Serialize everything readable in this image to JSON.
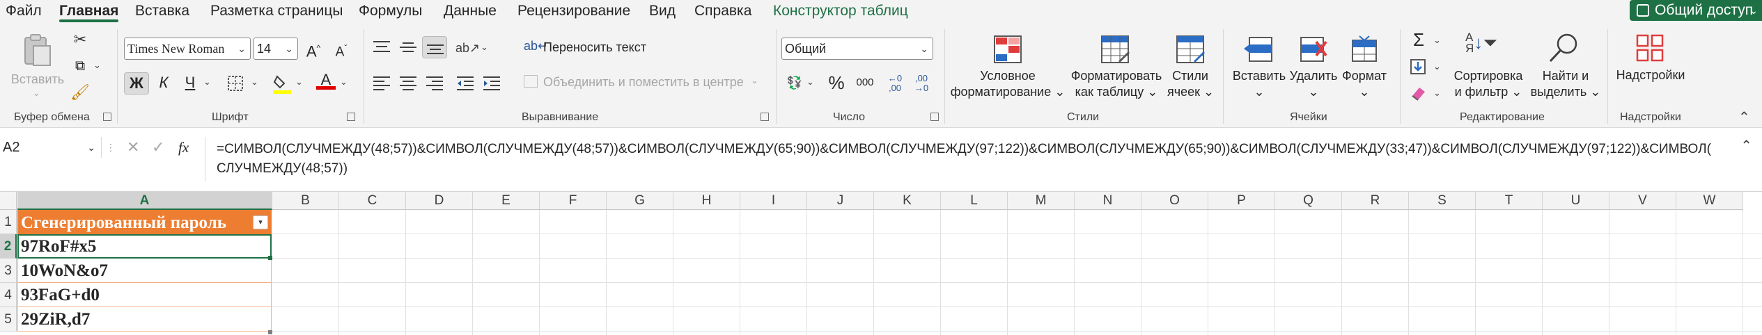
{
  "tabs": [
    "Файл",
    "Главная",
    "Вставка",
    "Разметка страницы",
    "Формулы",
    "Данные",
    "Рецензирование",
    "Вид",
    "Справка",
    "Конструктор таблиц"
  ],
  "active_tab": "Главная",
  "share_button": "Общий доступ",
  "clipboard": {
    "paste_label": "Вставить",
    "group_label": "Буфер обмена"
  },
  "font": {
    "family": "Times New Roman",
    "size": "14",
    "bold": "Ж",
    "italic": "К",
    "underline": "Ч",
    "group_label": "Шрифт"
  },
  "alignment": {
    "wrap_text": "Переносить текст",
    "merge_center": "Объединить и поместить в центре",
    "group_label": "Выравнивание"
  },
  "number": {
    "format": "Общий",
    "percent": "%",
    "thousands": "000",
    "group_label": "Число"
  },
  "styles": {
    "conditional_line1": "Условное",
    "conditional_line2": "форматирование",
    "format_table_line1": "Форматировать",
    "format_table_line2": "как таблицу",
    "cell_styles_line1": "Стили",
    "cell_styles_line2": "ячеек",
    "group_label": "Стили"
  },
  "cells_group": {
    "insert": "Вставить",
    "delete": "Удалить",
    "format": "Формат",
    "group_label": "Ячейки"
  },
  "editing": {
    "sum": "Σ",
    "sort_line1": "Сортировка",
    "sort_line2": "и фильтр",
    "find_line1": "Найти и",
    "find_line2": "выделить",
    "group_label": "Редактирование"
  },
  "addins": {
    "label": "Надстройки",
    "group_label": "Надстройки"
  },
  "formula_bar": {
    "name_box": "A2",
    "fx": "fx",
    "formula_line1": "=СИМВОЛ(СЛУЧМЕЖДУ(48;57))&СИМВОЛ(СЛУЧМЕЖДУ(48;57))&СИМВОЛ(СЛУЧМЕЖДУ(65;90))&СИМВОЛ(СЛУЧМЕЖДУ(97;122))&СИМВОЛ(СЛУЧМЕЖДУ(65;90))&СИМВОЛ(СЛУЧМЕЖДУ(33;47))&СИМВОЛ(СЛУЧМЕЖДУ(97;122))&СИМВОЛ(",
    "formula_line2": "СЛУЧМЕЖДУ(48;57))"
  },
  "columns": [
    "A",
    "B",
    "C",
    "D",
    "E",
    "F",
    "G",
    "H",
    "I",
    "J",
    "K",
    "L",
    "M",
    "N",
    "O",
    "P",
    "Q",
    "R",
    "S",
    "T",
    "U",
    "V",
    "W"
  ],
  "rows": [
    "1",
    "2",
    "3",
    "4",
    "5"
  ],
  "table": {
    "header": "Сгенерированный пароль",
    "values": [
      "97RoF#x5",
      "10WoN&o7",
      "93FaG+d0",
      "29ZiR,d7"
    ]
  },
  "colors": {
    "accent": "#1e7145",
    "table_header": "#ed7d31",
    "table_border": "#f4b183"
  }
}
